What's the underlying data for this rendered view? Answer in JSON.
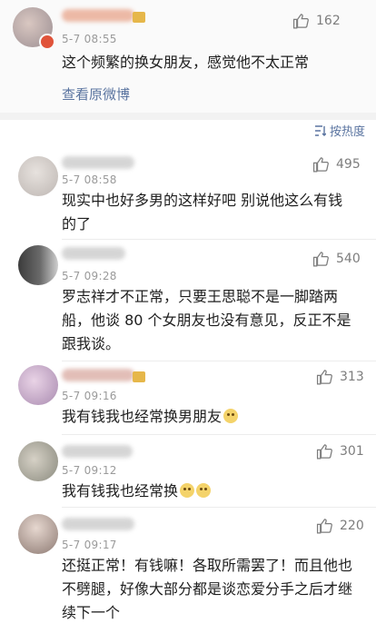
{
  "post": {
    "time": "5-7 08:55",
    "text": "这个频繁的换女朋友，感觉他不太正常",
    "view_original": "查看原微博",
    "likes": "162"
  },
  "sort": {
    "label": "按热度"
  },
  "comments": [
    {
      "time": "5-7 08:58",
      "likes": "495",
      "lines": [
        "现实中也好多男的这样好吧  别说他这么有钱",
        "的了"
      ]
    },
    {
      "time": "5-7 09:28",
      "likes": "540",
      "lines": [
        "罗志祥才不正常，只要王思聪不是一脚踏两",
        "船，他谈 80 个女朋友也没有意见，反正不是",
        "跟我谈。"
      ]
    },
    {
      "time": "5-7 09:16",
      "likes": "313",
      "lines": [
        "我有钱我也经常换男朋友"
      ]
    },
    {
      "time": "5-7 09:12",
      "likes": "301",
      "lines": [
        "我有钱我也经常换"
      ]
    },
    {
      "time": "5-7 09:17",
      "likes": "220",
      "lines": [
        "还挺正常！有钱嘛！各取所需罢了！而且他也",
        "不劈腿，好像大部分都是谈恋爱分手之后才继",
        "续下一个"
      ]
    }
  ]
}
